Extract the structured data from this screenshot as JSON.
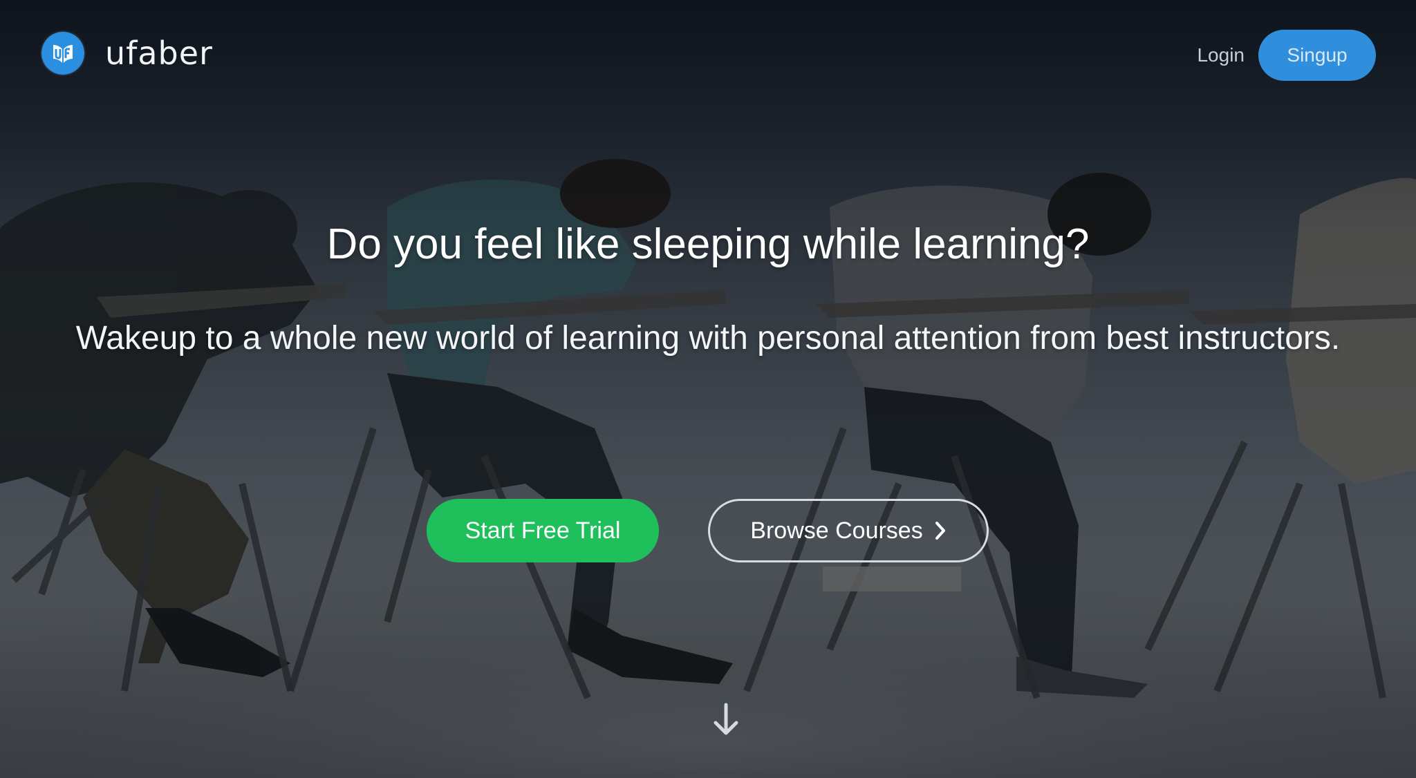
{
  "brand": {
    "name": "ufaber",
    "logo_icon": "ufaber-logo-icon",
    "logo_color": "#2a8fe0"
  },
  "nav": {
    "login_label": "Login",
    "signup_label": "Singup",
    "signup_color": "#2f8fdc"
  },
  "hero": {
    "headline": "Do you feel like sleeping while learning?",
    "subheadline": "Wakeup to a whole new world of learning with personal attention from best instructors.",
    "primary_cta": "Start Free Trial",
    "primary_cta_color": "#1fbf5b",
    "secondary_cta": "Browse Courses",
    "secondary_cta_icon": "chevron-right-icon",
    "scroll_icon": "arrow-down-icon",
    "background_image": "students-sleeping-at-desks"
  }
}
